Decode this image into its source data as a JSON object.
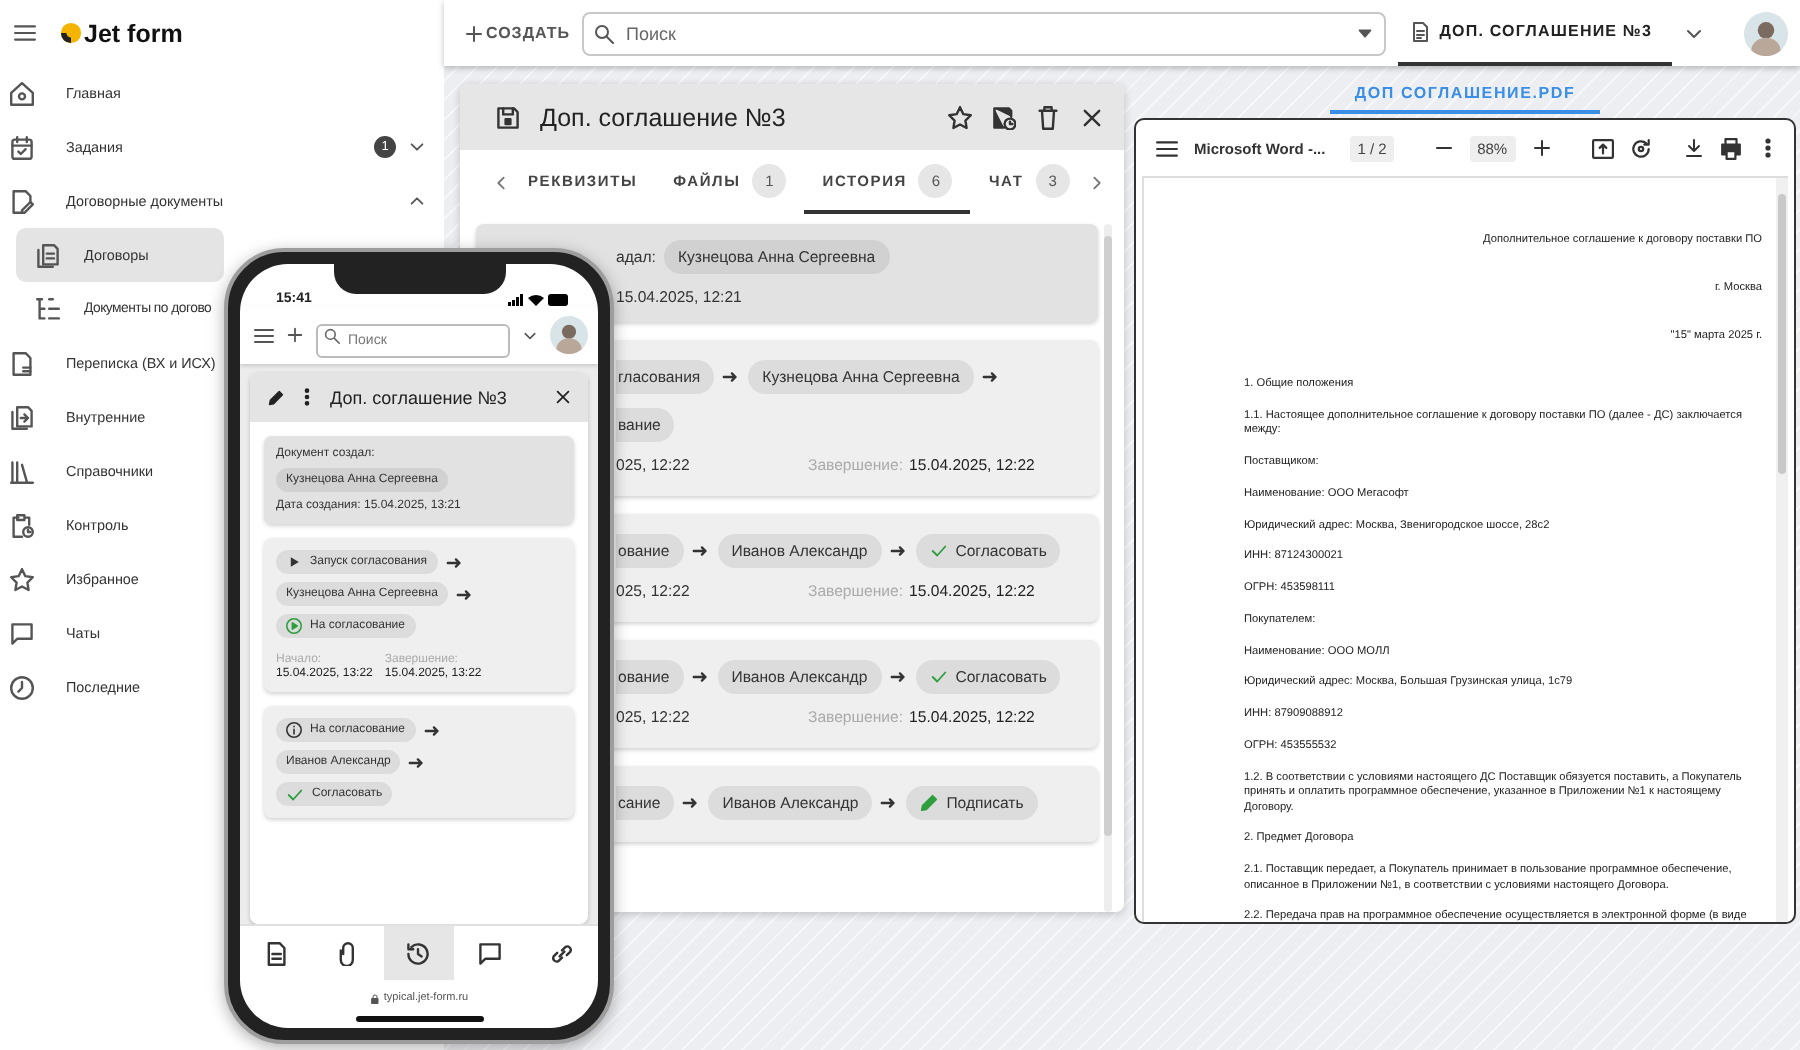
{
  "sidebar": {
    "logo": "Jet form",
    "items": [
      {
        "label": "Главная",
        "selected": false
      },
      {
        "label": "Задания",
        "badge": "1",
        "expanded": false,
        "selected": false
      },
      {
        "label": "Договорные документы",
        "expanded": true,
        "selected": false,
        "children": [
          {
            "label": "Договоры",
            "selected": true
          },
          {
            "label": "Документы по догово",
            "selected": false
          }
        ]
      },
      {
        "label": "Переписка (ВХ и ИСХ)",
        "selected": false
      },
      {
        "label": "Внутренние",
        "selected": false
      },
      {
        "label": "Справочники",
        "selected": false
      },
      {
        "label": "Контроль",
        "selected": false
      },
      {
        "label": "Избранное",
        "selected": false
      },
      {
        "label": "Чаты",
        "selected": false
      },
      {
        "label": "Последние",
        "selected": false
      }
    ]
  },
  "topbar": {
    "create": "СОЗДАТЬ",
    "search": {
      "placeholder": "Поиск"
    },
    "open_tab": {
      "label": "ДОП. СОГЛАШЕНИЕ №3",
      "selected": true
    }
  },
  "doc_panel": {
    "title": "Доп. соглашение №3",
    "tabs": [
      {
        "label": "РЕКВИЗИТЫ",
        "selected": false
      },
      {
        "label": "ФАЙЛЫ",
        "count": "1",
        "selected": false
      },
      {
        "label": "ИСТОРИЯ",
        "count": "6",
        "selected": true
      },
      {
        "label": "ЧАТ",
        "count": "3",
        "selected": false
      }
    ],
    "cards": [
      {
        "kind": "created",
        "rows": [
          [
            {
              "kind": "text",
              "text": "адал:"
            },
            {
              "kind": "chip",
              "text": "Кузнецова Анна Сергеевна"
            }
          ],
          [
            {
              "kind": "text",
              "text": "15.04.2025, 12:21"
            }
          ]
        ]
      },
      {
        "kind": "step",
        "rows": [
          [
            {
              "kind": "cut",
              "text": "гласования"
            },
            {
              "kind": "arrow"
            },
            {
              "kind": "chip",
              "text": "Кузнецова Анна Сергеевна"
            },
            {
              "kind": "arrow"
            }
          ],
          [
            {
              "kind": "cut",
              "text": "вание"
            }
          ],
          [
            {
              "kind": "dates",
              "start": "025, 12:22",
              "end_label": "Завершение:",
              "end": "15.04.2025, 12:22"
            }
          ]
        ]
      },
      {
        "kind": "step",
        "rows": [
          [
            {
              "kind": "cut",
              "text": "ование"
            },
            {
              "kind": "arrow"
            },
            {
              "kind": "chip",
              "text": "Иванов Александр"
            },
            {
              "kind": "arrow"
            },
            {
              "kind": "approve",
              "text": "Согласовать"
            }
          ],
          [
            {
              "kind": "dates",
              "start": "025, 12:22",
              "end_label": "Завершение:",
              "end": "15.04.2025, 12:22"
            }
          ]
        ]
      },
      {
        "kind": "step",
        "rows": [
          [
            {
              "kind": "cut",
              "text": "ование"
            },
            {
              "kind": "arrow"
            },
            {
              "kind": "chip",
              "text": "Иванов Александр"
            },
            {
              "kind": "arrow"
            },
            {
              "kind": "approve",
              "text": "Согласовать"
            }
          ],
          [
            {
              "kind": "dates",
              "start": "025, 12:22",
              "end_label": "Завершение:",
              "end": "15.04.2025, 12:22"
            }
          ]
        ]
      },
      {
        "kind": "step",
        "rows": [
          [
            {
              "kind": "cut",
              "text": "сание"
            },
            {
              "kind": "arrow"
            },
            {
              "kind": "chip",
              "text": "Иванов Александр"
            },
            {
              "kind": "arrow"
            },
            {
              "kind": "sign",
              "text": "Подписать"
            }
          ]
        ]
      }
    ]
  },
  "pdf_panel": {
    "tab": "ДОП СОГЛАШЕНИЕ.PDF",
    "file": "Microsoft Word -...",
    "page": "1 / 2",
    "zoom": "88%",
    "lines": [
      {
        "kind": "right",
        "text": "Дополнительное соглашение к договору поставки ПО"
      },
      {
        "kind": "right",
        "text": "г. Москва"
      },
      {
        "kind": "right",
        "text": "\"15\" марта 2025 г."
      },
      {
        "kind": "para",
        "text": "1. Общие положения"
      },
      {
        "kind": "para",
        "text": "1.1. Настоящее дополнительное соглашение к договору поставки ПО (далее - ДС) заключается между:"
      },
      {
        "kind": "para",
        "text": "Поставщиком:"
      },
      {
        "kind": "para",
        "text": "Наименование: ООО Мегасофт"
      },
      {
        "kind": "para",
        "text": "Юридический адрес: Москва, Звенигородское шоссе, 28с2"
      },
      {
        "kind": "para",
        "text": "ИНН: 87124300021"
      },
      {
        "kind": "para",
        "text": "ОГРН: 453598111"
      },
      {
        "kind": "para",
        "text": "Покупателем:"
      },
      {
        "kind": "para",
        "text": "Наименование: ООО МОЛЛ"
      },
      {
        "kind": "para",
        "text": "Юридический адрес: Москва, Большая Грузинская улица, 1с79"
      },
      {
        "kind": "para",
        "text": "ИНН: 87909088912"
      },
      {
        "kind": "para",
        "text": "ОГРН: 453555532"
      },
      {
        "kind": "para",
        "text": "1.2. В соответствии с условиями настоящего ДС Поставщик обязуется поставить, а Покупатель принять и оплатить программное обеспечение, указанное в Приложении №1 к настоящему Договору."
      },
      {
        "kind": "para",
        "text": "2. Предмет Договора"
      },
      {
        "kind": "para",
        "text": "2.1. Поставщик передает, а Покупатель принимает в пользование программное обеспечение, описанное в Приложении №1, в соответствии с условиями настоящего Договора."
      },
      {
        "kind": "para",
        "text": "2.2. Передача прав на программное обеспечение осуществляется в электронной форме (в виде"
      }
    ]
  },
  "phone": {
    "time": "15:41",
    "search": {
      "placeholder": "Поиск"
    },
    "title": "Доп. соглашение №3",
    "cards": [
      {
        "kind": "created",
        "rows": [
          [
            {
              "kind": "text",
              "text": "Документ создал:"
            }
          ],
          [
            {
              "kind": "chip",
              "text": "Кузнецова Анна Сергеевна"
            }
          ],
          [
            {
              "kind": "text",
              "text": "Дата создания: 15.04.2025, 13:21"
            }
          ]
        ]
      },
      {
        "kind": "step",
        "rows": [
          [
            {
              "kind": "start",
              "text": "Запуск согласования"
            },
            {
              "kind": "arrow"
            }
          ],
          [
            {
              "kind": "chip",
              "text": "Кузнецова Анна Сергеевна"
            },
            {
              "kind": "arrow"
            }
          ],
          [
            {
              "kind": "pending",
              "text": "На согласование"
            }
          ],
          [
            {
              "kind": "dates_stacked",
              "start_label": "Начало:",
              "start": "15.04.2025, 13:22",
              "end_label": "Завершение:",
              "end": "15.04.2025, 13:22"
            }
          ]
        ]
      },
      {
        "kind": "step",
        "rows": [
          [
            {
              "kind": "info",
              "text": "На согласование"
            },
            {
              "kind": "arrow"
            }
          ],
          [
            {
              "kind": "chip",
              "text": "Иванов Александр"
            },
            {
              "kind": "arrow"
            }
          ],
          [
            {
              "kind": "approve",
              "text": "Согласовать"
            }
          ]
        ]
      }
    ],
    "nav": [
      {
        "selected": false
      },
      {
        "selected": false
      },
      {
        "selected": true
      },
      {
        "selected": false
      },
      {
        "selected": false
      }
    ],
    "url": "typical.jet-form.ru"
  }
}
